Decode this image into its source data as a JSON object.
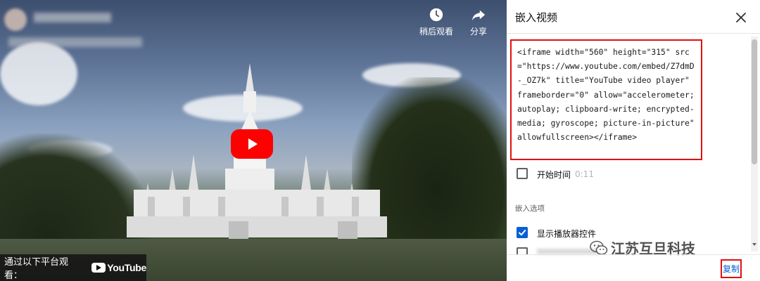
{
  "video": {
    "top_actions": {
      "watch_later_label": "稍后观看",
      "share_label": "分享"
    },
    "watch_on": {
      "label": "通过以下平台观看：",
      "platform": "YouTube"
    }
  },
  "embed_panel": {
    "title": "嵌入视频",
    "code": "<iframe width=\"560\" height=\"315\" src=\"https://www.youtube.com/embed/Z7dmD-_OZ7k\" title=\"YouTube video player\" frameborder=\"0\" allow=\"accelerometer; autoplay; clipboard-write; encrypted-media; gyroscope; picture-in-picture\" allowfullscreen></iframe>",
    "start_time": {
      "label": "开始时间",
      "value": "0:11",
      "checked": false
    },
    "options_heading": "嵌入选项",
    "show_controls": {
      "label": "显示播放器控件",
      "checked": true
    },
    "copy_label": "复制"
  },
  "watermark": {
    "text": "江苏互旦科技"
  },
  "colors": {
    "highlight_red": "#e01010",
    "youtube_red": "#ff0000",
    "checkbox_blue": "#065fd4"
  }
}
